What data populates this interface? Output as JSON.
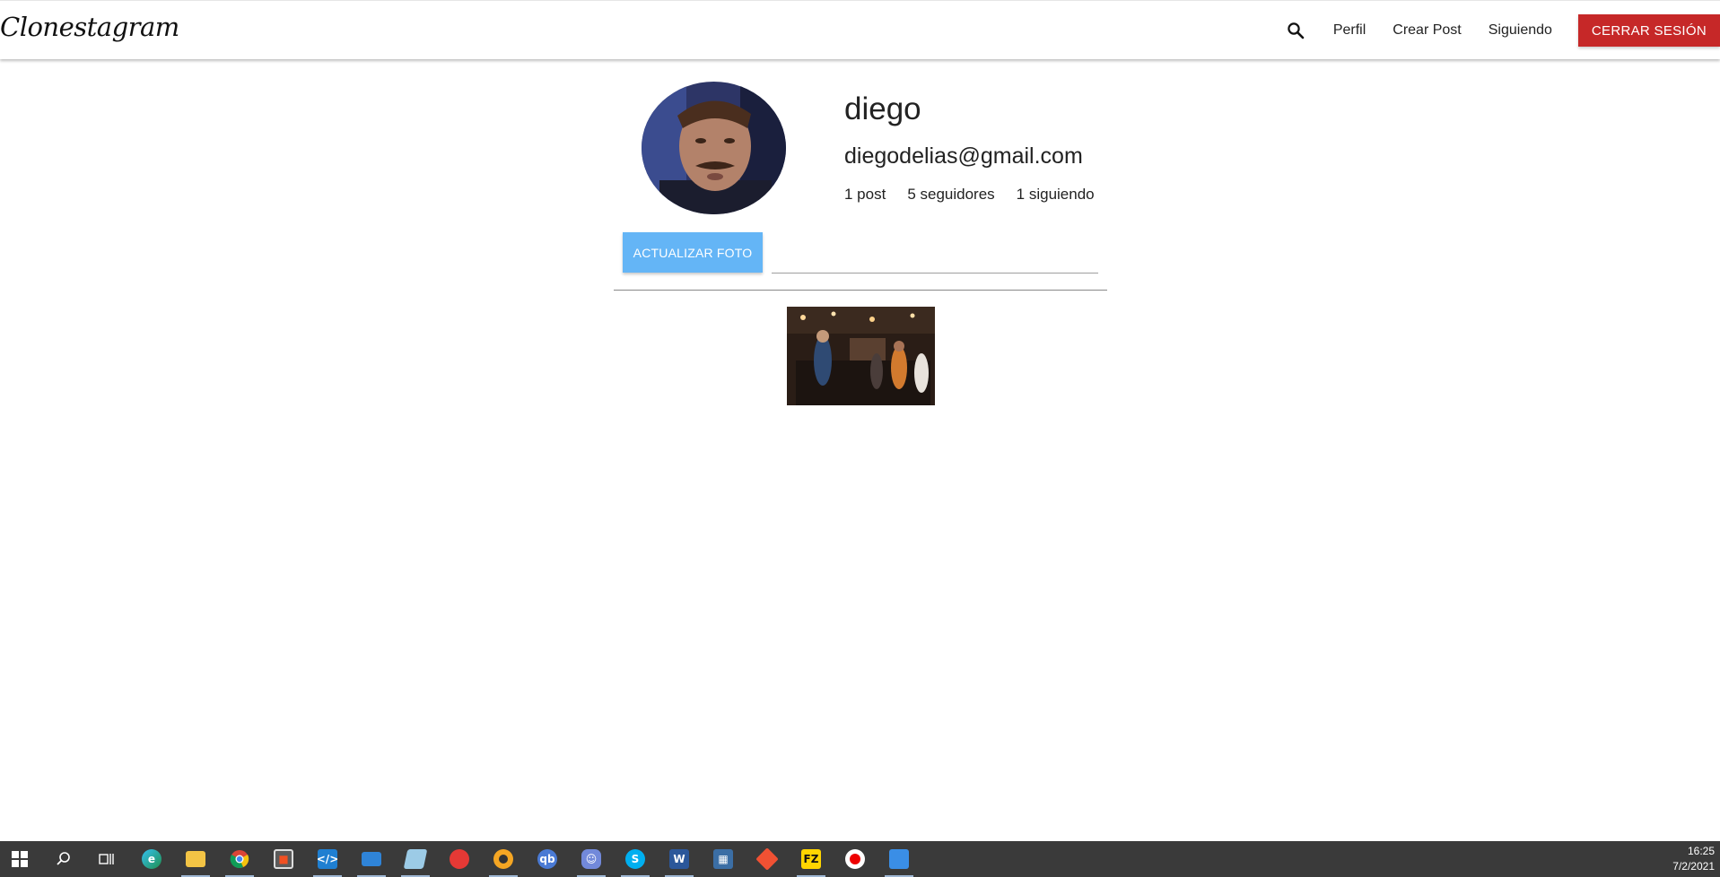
{
  "nav": {
    "brand": "Clonestagram",
    "links": [
      "Perfil",
      "Crear Post",
      "Siguiendo"
    ],
    "logout_label": "CERRAR SESIÓN"
  },
  "profile": {
    "username": "diego",
    "email": "diegodelias@gmail.com",
    "stats": {
      "posts": "1 post",
      "followers": "5 seguidores",
      "following": "1 siguiendo"
    },
    "update_photo_label": "ACTUALIZAR FOTO"
  },
  "colors": {
    "logout": "#c62828",
    "update_button": "#64b5f6",
    "taskbar": "#3a3a3a"
  },
  "taskbar": {
    "time": "16:25",
    "date": "7/2/2021",
    "icons": [
      "windows-start-icon",
      "search-icon",
      "task-view-icon",
      "edge-icon",
      "file-explorer-icon",
      "chrome-icon",
      "store-icon",
      "vscode-icon",
      "mail-icon",
      "notepad-icon",
      "tomato-icon",
      "obs-icon",
      "qbittorrent-icon",
      "discord-icon",
      "skype-icon",
      "word-icon",
      "calculator-icon",
      "git-icon",
      "filezilla-icon",
      "recorder-icon",
      "photos-icon"
    ]
  }
}
